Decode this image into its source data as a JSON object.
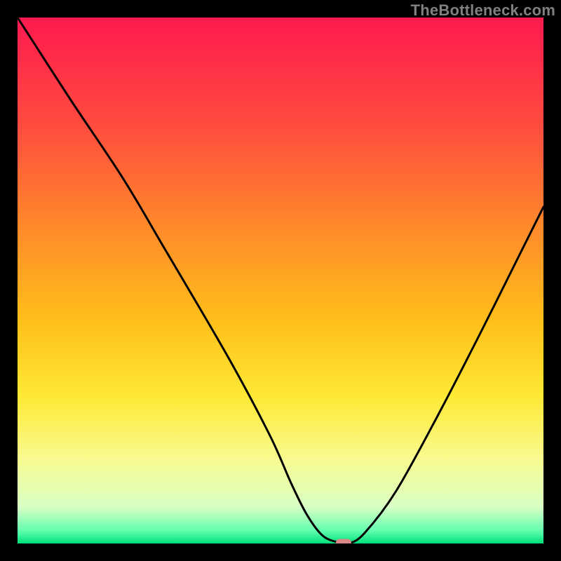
{
  "watermark": "TheBottleneck.com",
  "colors": {
    "frame": "#000000",
    "gradient_stops": [
      {
        "offset": 0.0,
        "color": "#ff1a4f"
      },
      {
        "offset": 0.2,
        "color": "#ff4a3f"
      },
      {
        "offset": 0.4,
        "color": "#ff8a2a"
      },
      {
        "offset": 0.58,
        "color": "#ffc01a"
      },
      {
        "offset": 0.72,
        "color": "#ffe935"
      },
      {
        "offset": 0.84,
        "color": "#f8fb90"
      },
      {
        "offset": 0.93,
        "color": "#d9ffc4"
      },
      {
        "offset": 0.975,
        "color": "#65ffb0"
      },
      {
        "offset": 1.0,
        "color": "#00e07a"
      }
    ],
    "curve": "#000000",
    "marker": "#d98885"
  },
  "chart_data": {
    "type": "line",
    "title": "",
    "xlabel": "",
    "ylabel": "",
    "xlim": [
      0,
      100
    ],
    "ylim": [
      0,
      100
    ],
    "legend": false,
    "grid": false,
    "series": [
      {
        "name": "bottleneck-curve",
        "x": [
          0,
          10,
          20,
          28,
          40,
          48,
          52,
          55,
          58,
          61,
          63,
          66,
          72,
          80,
          88,
          96,
          100
        ],
        "values": [
          100,
          84.5,
          69.5,
          56.0,
          35.5,
          20.5,
          11.5,
          5.5,
          1.5,
          0.2,
          0.0,
          2.0,
          10.0,
          24.5,
          40.0,
          56.0,
          64.0
        ]
      }
    ],
    "marker": {
      "x": 62,
      "y": 0.2
    }
  }
}
